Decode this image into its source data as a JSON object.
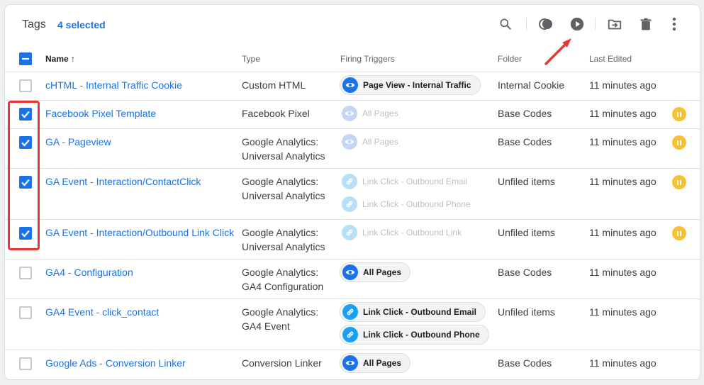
{
  "header": {
    "title": "Tags",
    "selected": "4 selected",
    "toolbar": [
      "search-icon",
      "merge-icon",
      "play-icon",
      "move-to-folder-icon",
      "delete-icon",
      "more-vert-icon"
    ]
  },
  "columns": {
    "name": "Name",
    "sort_arrow": "↑",
    "type": "Type",
    "triggers": "Firing Triggers",
    "folder": "Folder",
    "edited": "Last Edited"
  },
  "colors": {
    "accent": "#1a73e8",
    "link_trigger": "#1ba0f2",
    "pause_badge": "#f6c232",
    "highlight": "#e53935"
  },
  "rows": [
    {
      "name": "cHTML - Internal Traffic Cookie",
      "type": [
        "Custom HTML"
      ],
      "triggers": [
        {
          "label": "Page View - Internal Traffic",
          "icon": "eye-icon",
          "active": true
        }
      ],
      "folder": "Internal Cookie",
      "edited": "11 minutes ago",
      "checked": false,
      "paused": false
    },
    {
      "name": "Facebook Pixel Template",
      "type": [
        "Facebook Pixel"
      ],
      "triggers": [
        {
          "label": "All Pages",
          "icon": "eye-icon",
          "active": false
        }
      ],
      "folder": "Base Codes",
      "edited": "11 minutes ago",
      "checked": true,
      "paused": true
    },
    {
      "name": "GA - Pageview",
      "type": [
        "Google Analytics:",
        "Universal Analytics"
      ],
      "triggers": [
        {
          "label": "All Pages",
          "icon": "eye-icon",
          "active": false
        }
      ],
      "folder": "Base Codes",
      "edited": "11 minutes ago",
      "checked": true,
      "paused": true
    },
    {
      "name": "GA Event - Interaction/ContactClick",
      "type": [
        "Google Analytics:",
        "Universal Analytics"
      ],
      "triggers": [
        {
          "label": "Link Click - Outbound Email",
          "icon": "link-icon",
          "active": false
        },
        {
          "label": "Link Click - Outbound Phone",
          "icon": "link-icon",
          "active": false
        }
      ],
      "folder": "Unfiled items",
      "edited": "11 minutes ago",
      "checked": true,
      "paused": true
    },
    {
      "name": "GA Event - Interaction/Outbound Link Click",
      "type": [
        "Google Analytics:",
        "Universal Analytics"
      ],
      "triggers": [
        {
          "label": "Link Click - Outbound Link",
          "icon": "link-icon",
          "active": false
        }
      ],
      "folder": "Unfiled items",
      "edited": "11 minutes ago",
      "checked": true,
      "paused": true
    },
    {
      "name": "GA4 - Configuration",
      "type": [
        "Google Analytics:",
        "GA4 Configuration"
      ],
      "triggers": [
        {
          "label": "All Pages",
          "icon": "eye-icon",
          "active": true
        }
      ],
      "folder": "Base Codes",
      "edited": "11 minutes ago",
      "checked": false,
      "paused": false
    },
    {
      "name": "GA4 Event - click_contact",
      "type": [
        "Google Analytics:",
        "GA4 Event"
      ],
      "triggers": [
        {
          "label": "Link Click - Outbound Email",
          "icon": "link-icon",
          "active": true
        },
        {
          "label": "Link Click - Outbound Phone",
          "icon": "link-icon",
          "active": true
        }
      ],
      "folder": "Unfiled items",
      "edited": "11 minutes ago",
      "checked": false,
      "paused": false
    },
    {
      "name": "Google Ads - Conversion Linker",
      "type": [
        "Conversion Linker"
      ],
      "triggers": [
        {
          "label": "All Pages",
          "icon": "eye-icon",
          "active": true
        }
      ],
      "folder": "Base Codes",
      "edited": "11 minutes ago",
      "checked": false,
      "paused": false
    }
  ]
}
